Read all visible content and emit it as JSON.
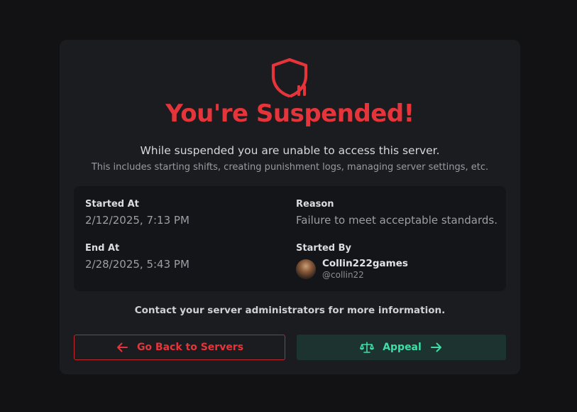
{
  "title": "You're Suspended!",
  "subtitle": "While suspended you are unable to access this server.",
  "subtext": "This includes starting shifts, creating punishment logs, managing server settings, etc.",
  "details": {
    "started_at_label": "Started At",
    "started_at_value": "2/12/2025, 7:13 PM",
    "end_at_label": "End At",
    "end_at_value": "2/28/2025, 5:43 PM",
    "reason_label": "Reason",
    "reason_value": "Failure to meet acceptable standards.",
    "started_by_label": "Started By",
    "started_by_name": "Collin222games",
    "started_by_handle": "@collin22"
  },
  "contact": "Contact your server administrators for more information.",
  "buttons": {
    "back_label": "Go Back to Servers",
    "appeal_label": "Appeal"
  },
  "icons": {
    "header": "shield-pause-icon",
    "back": "arrow-left-icon",
    "appeal": "scale-icon",
    "appeal_trailing": "arrow-right-icon"
  },
  "colors": {
    "accent_red": "#e5353a",
    "accent_green": "#3ddfa7",
    "card_bg": "#1b1c20",
    "page_bg": "#121214"
  }
}
